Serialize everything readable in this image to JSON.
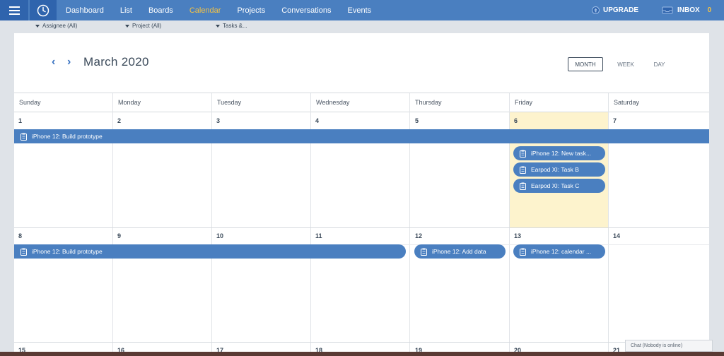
{
  "topbar": {
    "menu_icon": "hamburger-icon",
    "logo_icon": "clock-icon",
    "nav": [
      {
        "label": "Dashboard",
        "active": false
      },
      {
        "label": "List",
        "active": false
      },
      {
        "label": "Boards",
        "active": false
      },
      {
        "label": "Calendar",
        "active": true
      },
      {
        "label": "Projects",
        "active": false
      },
      {
        "label": "Conversations",
        "active": false
      },
      {
        "label": "Events",
        "active": false
      }
    ],
    "upgrade_label": "UPGRADE",
    "inbox_label": "INBOX",
    "inbox_count": "0"
  },
  "filters": {
    "assignee": "Assignee (All)",
    "project": "Project (All)",
    "tasks": "Tasks &..."
  },
  "calendar": {
    "title": "March 2020",
    "views": [
      "MONTH",
      "WEEK",
      "DAY"
    ],
    "selected_view": "MONTH",
    "weekdays": [
      "Sunday",
      "Monday",
      "Tuesday",
      "Wednesday",
      "Thursday",
      "Friday",
      "Saturday"
    ],
    "weeks": [
      [
        "1",
        "2",
        "3",
        "4",
        "5",
        "6",
        "7"
      ],
      [
        "8",
        "9",
        "10",
        "11",
        "12",
        "13",
        "14"
      ],
      [
        "15",
        "16",
        "17",
        "18",
        "19",
        "20",
        "21"
      ]
    ],
    "today": "6",
    "events": {
      "w1_span": "iPhone 12: Build prototype",
      "fri_1": "iPhone 12: New task...",
      "fri_2": "Earpod XI: Task B",
      "fri_3": "Earpod XI: Task C",
      "w2_span": "iPhone 12: Build prototype",
      "thu_w2": "iPhone 12: Add data",
      "fri_w2": "iPhone 12: calendar ..."
    }
  },
  "chat": {
    "label": "Chat (Nobody is online)"
  },
  "colors": {
    "topbar": "#4a7fc0",
    "topbar_dark": "#2f64ad",
    "accent": "#f6c343",
    "event": "#4a7fc0",
    "today": "#fdf3cd"
  }
}
